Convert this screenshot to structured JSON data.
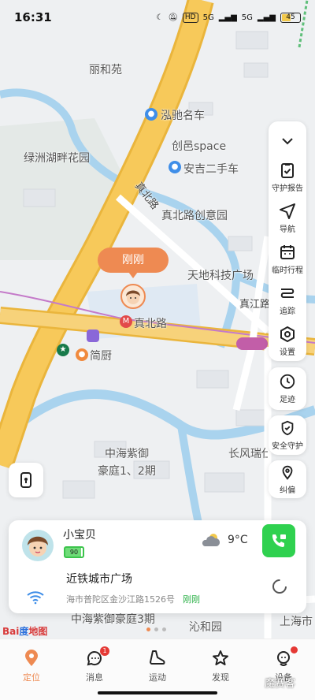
{
  "status_bar": {
    "time": "16:31",
    "network_chip": "HD",
    "signal1": "5G",
    "signal2": "5G",
    "battery": "45"
  },
  "map": {
    "labels": {
      "liheyuan": "丽和苑",
      "hongchi": "泓驰名车",
      "lvzhou": "绿洲湖畔花园",
      "chuangyi": "创邑space",
      "anji": "安吉二手车",
      "zhenbei_chuangyi": "真北路创意园",
      "tiandi": "天地科技广场",
      "zhenbeilu_station": "真北路",
      "jiandu": "简厨",
      "zhonghai": "中海紫御",
      "haoting": "豪庭1、2期",
      "changfeng": "长风瑞仕禄庭",
      "zhonghai3": "中海紫御豪庭3期",
      "qinheyuan": "沁和园",
      "shanghai_city": "上海市",
      "road_zhenbei": "真北路",
      "road_zhenjiang": "真江路"
    },
    "marker_label": "刚刚",
    "baidu_logo": "Bai度地图"
  },
  "toolbar": {
    "items": [
      {
        "label": "守护报告",
        "icon": "report-icon"
      },
      {
        "label": "导航",
        "icon": "navigation-icon"
      },
      {
        "label": "临时行程",
        "icon": "calendar-icon"
      },
      {
        "label": "追踪",
        "icon": "track-icon"
      },
      {
        "label": "设置",
        "icon": "settings-icon"
      }
    ],
    "footprint": "足迹",
    "safety": "安全守护",
    "correction": "纠偏"
  },
  "card": {
    "name": "小宝贝",
    "battery_level": "90",
    "temperature": "9°C",
    "place": "近铁城市广场",
    "address": "海市普陀区金沙江路1526号",
    "updated": "刚刚"
  },
  "tabs": [
    {
      "label": "定位",
      "icon": "location-icon",
      "active": true
    },
    {
      "label": "消息",
      "icon": "message-icon",
      "badge": "1"
    },
    {
      "label": "运动",
      "icon": "shoe-icon"
    },
    {
      "label": "发现",
      "icon": "star-icon"
    },
    {
      "label": "设备",
      "icon": "device-icon"
    }
  ],
  "watermark": "魔赛客",
  "colors": {
    "accent": "#ee8a52",
    "call_green": "#2fd14f",
    "road_yellow": "#f7c95a",
    "river_blue": "#a9d3ee"
  }
}
